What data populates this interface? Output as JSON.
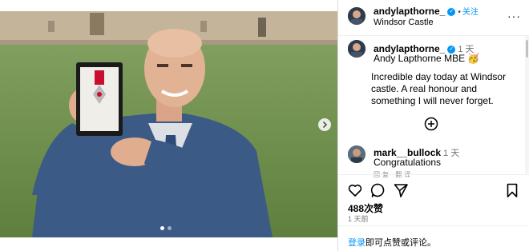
{
  "post": {
    "username": "andylapthorne_",
    "follow_label": "关注",
    "separator": "•",
    "location": "Windsor Castle",
    "more_glyph": "···"
  },
  "caption": {
    "username": "andylapthorne_",
    "time": "1 天",
    "title": "Andy Lapthorne MBE 🥳",
    "body": "Incredible day today at Windsor castle. A real honour and something I will never forget."
  },
  "comment": {
    "username": "mark__bullock",
    "time": "1 天",
    "text": "Congratulations",
    "truncated": "回复  翻译"
  },
  "stats": {
    "likes": "488次赞",
    "posted_ago": "1 天前"
  },
  "login": {
    "link": "登录",
    "text": "即可点赞或评论。"
  },
  "carousel": {
    "slide_count": 2,
    "active_slide": 1
  },
  "icons": [
    "heart-icon",
    "comment-icon",
    "share-icon",
    "bookmark-icon",
    "add-circle-icon",
    "chevron-right-icon",
    "verified-icon",
    "more-icon"
  ],
  "colors": {
    "link": "#0095f6",
    "muted": "#737373",
    "border": "#dbdbdb"
  }
}
